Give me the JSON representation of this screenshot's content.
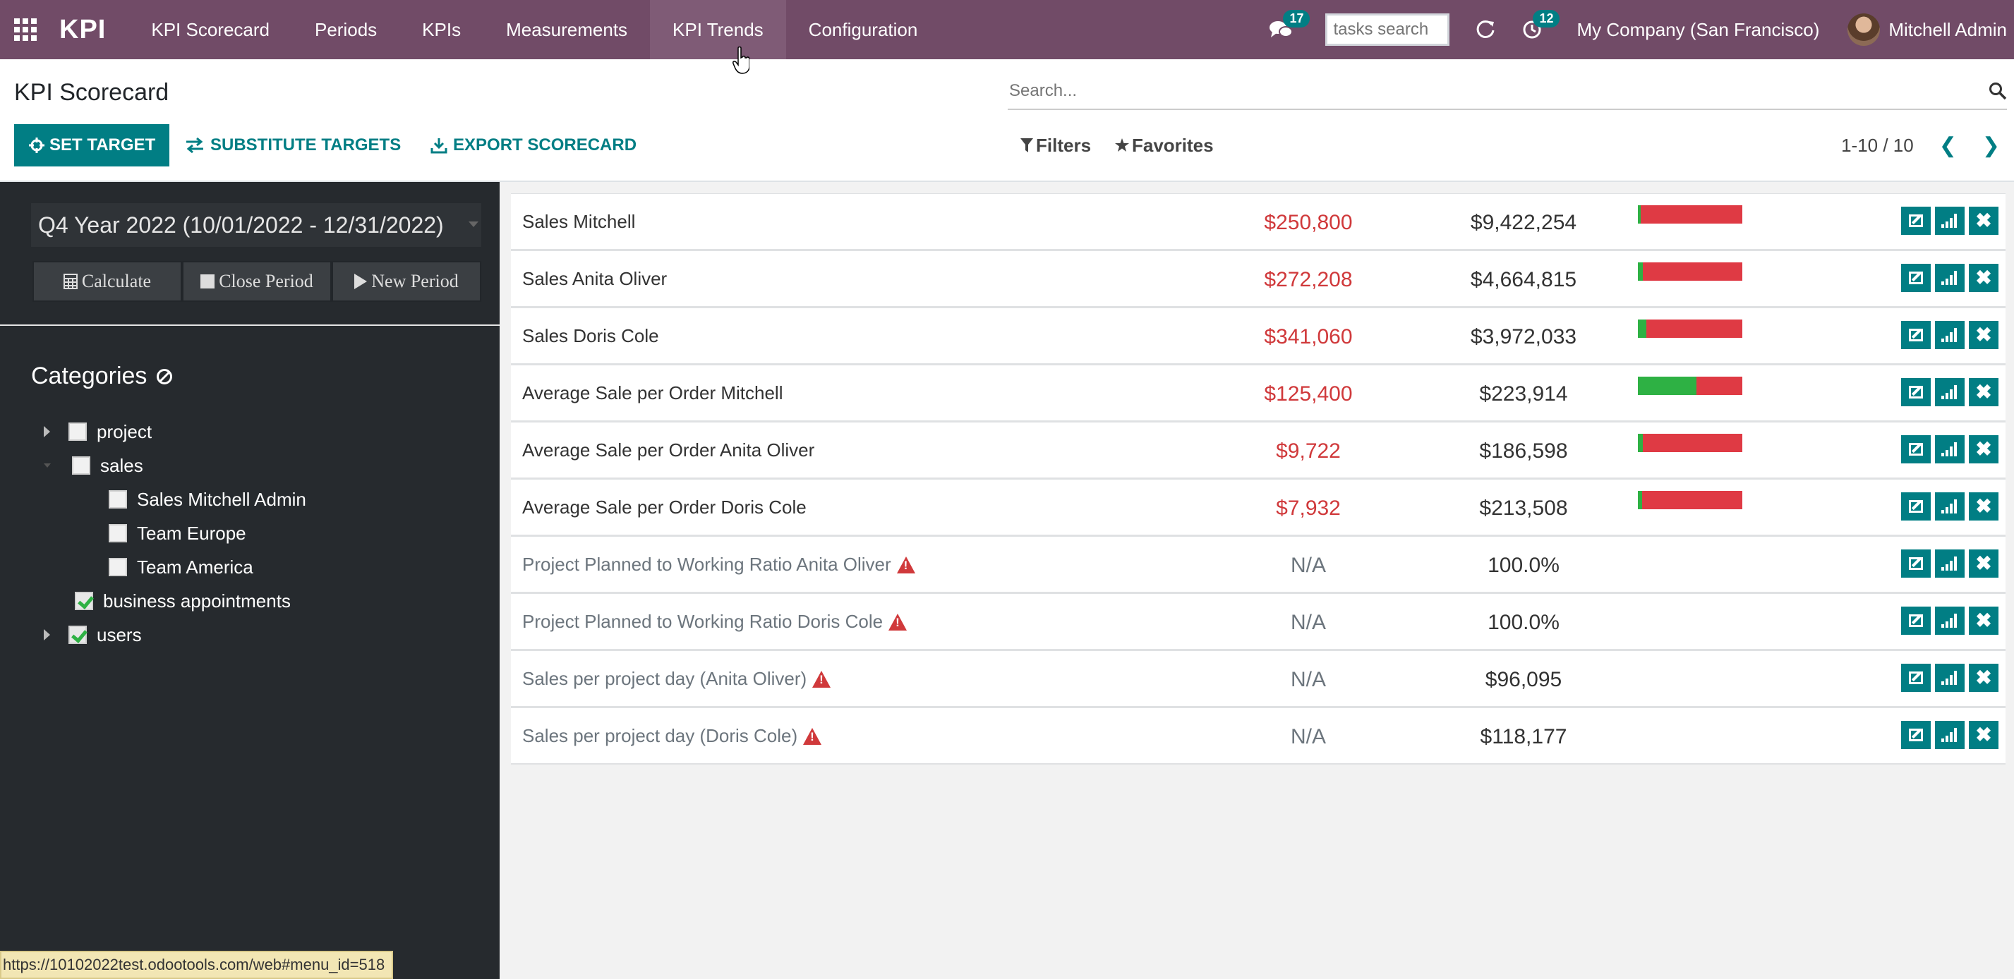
{
  "navbar": {
    "brand": "KPI",
    "menu": [
      "KPI Scorecard",
      "Periods",
      "KPIs",
      "Measurements",
      "KPI Trends",
      "Configuration"
    ],
    "messages_count": "17",
    "task_search_placeholder": "tasks search",
    "activities_count": "12",
    "company": "My Company (San Francisco)",
    "user": "Mitchell Admin"
  },
  "control_panel": {
    "title": "KPI Scorecard",
    "set_target": "SET TARGET",
    "substitute_targets": "SUBSTITUTE TARGETS",
    "export_scorecard": "EXPORT SCORECARD",
    "search_placeholder": "Search...",
    "filters": "Filters",
    "favorites": "Favorites",
    "pager": "1-10 / 10"
  },
  "sidebar": {
    "period": "Q4 Year 2022 (10/01/2022 - 12/31/2022)",
    "buttons": [
      "Calculate",
      "Close Period",
      "New Period"
    ],
    "categories_title": "Categories",
    "tree": [
      {
        "label": "project",
        "level": 0,
        "toggle": "closed",
        "checked": false
      },
      {
        "label": "sales",
        "level": 0,
        "toggle": "open",
        "checked": false
      },
      {
        "label": "Sales Mitchell Admin",
        "level": 1,
        "toggle": "none",
        "checked": false
      },
      {
        "label": "Team Europe",
        "level": 1,
        "toggle": "none",
        "checked": false
      },
      {
        "label": "Team America",
        "level": 1,
        "toggle": "none",
        "checked": false
      },
      {
        "label": "business appointments",
        "level": 0,
        "toggle": "none",
        "checked": true
      },
      {
        "label": "users",
        "level": 0,
        "toggle": "closed",
        "checked": true
      }
    ]
  },
  "kpis": [
    {
      "name": "Sales Mitchell",
      "target": "$250,800",
      "actual": "$9,422,254",
      "progress": 0.03,
      "warning": false
    },
    {
      "name": "Sales Anita Oliver",
      "target": "$272,208",
      "actual": "$4,664,815",
      "progress": 0.05,
      "warning": false
    },
    {
      "name": "Sales Doris Cole",
      "target": "$341,060",
      "actual": "$3,972,033",
      "progress": 0.08,
      "warning": false
    },
    {
      "name": "Average Sale per Order Mitchell",
      "target": "$125,400",
      "actual": "$223,914",
      "progress": 0.56,
      "warning": false
    },
    {
      "name": "Average Sale per Order Anita Oliver",
      "target": "$9,722",
      "actual": "$186,598",
      "progress": 0.05,
      "warning": false
    },
    {
      "name": "Average Sale per Order Doris Cole",
      "target": "$7,932",
      "actual": "$213,508",
      "progress": 0.04,
      "warning": false
    },
    {
      "name": "Project Planned to Working Ratio Anita Oliver",
      "target": "N/A",
      "actual": "100.0%",
      "progress": null,
      "warning": true
    },
    {
      "name": "Project Planned to Working Ratio Doris Cole",
      "target": "N/A",
      "actual": "100.0%",
      "progress": null,
      "warning": true
    },
    {
      "name": "Sales per project day (Anita Oliver)",
      "target": "N/A",
      "actual": "$96,095",
      "progress": null,
      "warning": true
    },
    {
      "name": "Sales per project day (Doris Cole)",
      "target": "N/A",
      "actual": "$118,177",
      "progress": null,
      "warning": true
    }
  ],
  "status_url": "https://10102022test.odootools.com/web#menu_id=518",
  "colors": {
    "navbar": "#714b67",
    "accent": "#017e84",
    "danger": "#df3a44",
    "success": "#2eb144"
  }
}
